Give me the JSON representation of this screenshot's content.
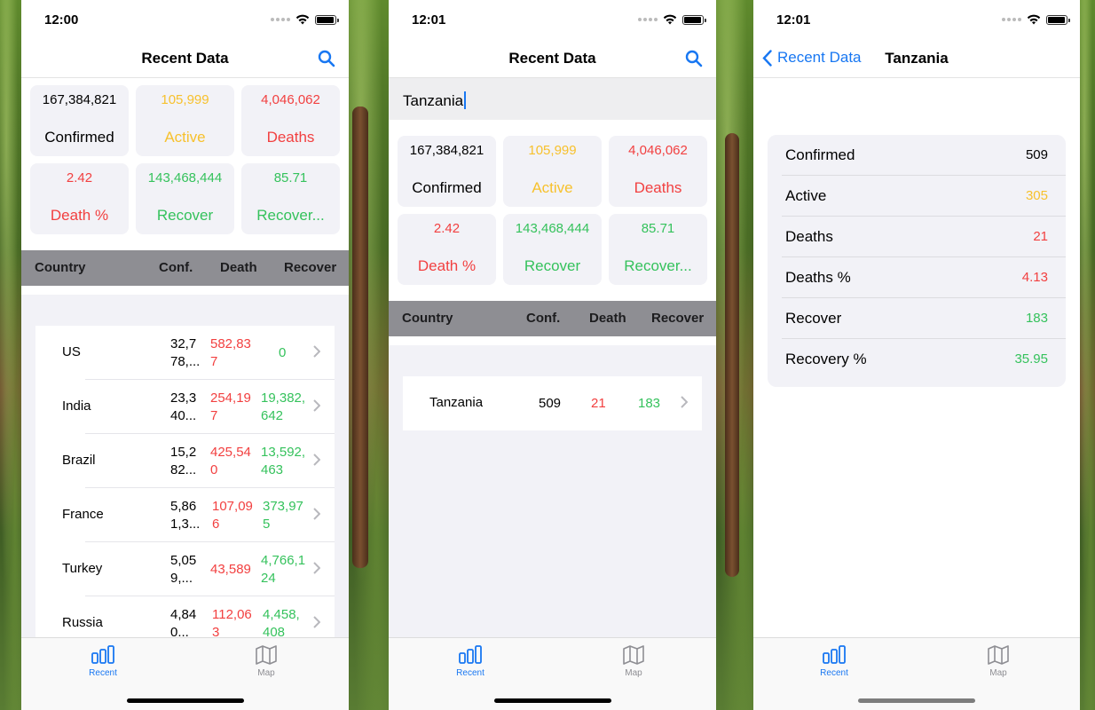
{
  "status": {
    "time1": "12:00",
    "time2": "12:01",
    "time3": "12:01"
  },
  "nav": {
    "title": "Recent Data",
    "back_label": "Recent Data",
    "detail_title": "Tanzania"
  },
  "summary": {
    "confirmed": {
      "value": "167,384,821",
      "label": "Confirmed"
    },
    "active": {
      "value": "105,999",
      "label": "Active"
    },
    "deaths": {
      "value": "4,046,062",
      "label": "Deaths"
    },
    "death_pct": {
      "value": "2.42",
      "label": "Death %"
    },
    "recover": {
      "value": "143,468,444",
      "label": "Recover"
    },
    "recover_pct": {
      "value": "85.71",
      "label": "Recover..."
    }
  },
  "table_header": {
    "country": "Country",
    "conf": "Conf.",
    "death": "Death",
    "recover": "Recover"
  },
  "countries": [
    {
      "name": "US",
      "conf": "32,778,...",
      "death": "582,837",
      "recover": "0"
    },
    {
      "name": "India",
      "conf": "23,340...",
      "death": "254,197",
      "recover": "19,382,642"
    },
    {
      "name": "Brazil",
      "conf": "15,282...",
      "death": "425,540",
      "recover": "13,592,463"
    },
    {
      "name": "France",
      "conf": "5,861,3...",
      "death": "107,096",
      "recover": "373,975"
    },
    {
      "name": "Turkey",
      "conf": "5,059,...",
      "death": "43,589",
      "recover": "4,766,124"
    },
    {
      "name": "Russia",
      "conf": "4,840...",
      "death": "112,063",
      "recover": "4,458,408"
    }
  ],
  "search": {
    "query": "Tanzania"
  },
  "search_result": {
    "name": "Tanzania",
    "conf": "509",
    "death": "21",
    "recover": "183"
  },
  "detail": [
    {
      "label": "Confirmed",
      "value": "509",
      "color": "#000000"
    },
    {
      "label": "Active",
      "value": "305",
      "color": "#f7c12d"
    },
    {
      "label": "Deaths",
      "value": "21",
      "color": "#f24040"
    },
    {
      "label": "Deaths %",
      "value": "4.13",
      "color": "#f24040"
    },
    {
      "label": "Recover",
      "value": "183",
      "color": "#35c25c"
    },
    {
      "label": "Recovery %",
      "value": "35.95",
      "color": "#35c25c"
    }
  ],
  "tabs": {
    "recent": "Recent",
    "map": "Map"
  },
  "colors": {
    "accent": "#1877f2",
    "yellow": "#f7c12d",
    "red": "#f24040",
    "green": "#35c25c"
  }
}
